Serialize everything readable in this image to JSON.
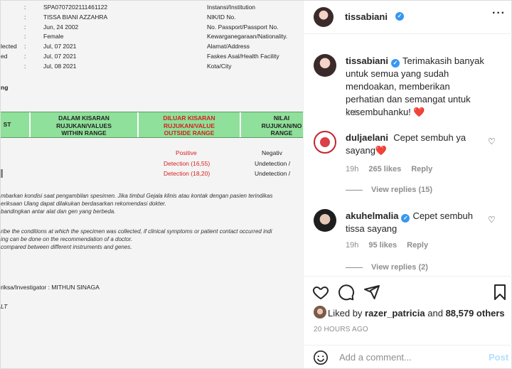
{
  "document": {
    "fields": [
      {
        "label": "",
        "value": "SPA0707202111461122"
      },
      {
        "label": "",
        "value": "TISSA BIANI AZZAHRA"
      },
      {
        "label": "",
        "value": "Jun, 24 2002"
      },
      {
        "label": "",
        "value": "Female"
      },
      {
        "label": "lected",
        "value": "Jul, 07 2021"
      },
      {
        "label": "ed",
        "value": "Jul, 07 2021"
      },
      {
        "label": "",
        "value": "Jul, 08 2021"
      }
    ],
    "right_labels": [
      "Instansi/Institution",
      "NIK/ID No.",
      "No. Passport/Passport No.",
      "Kewarganegaraan/Nationality.",
      "Alamat/Address",
      "Faskes Asal/Health Facility",
      "Kota/City"
    ],
    "section_fragment": "ng",
    "table_headers": {
      "col1": "ST",
      "col2": "DALAM KISARAN\nRUJUKAN/VALUES\nWITHIN RANGE",
      "col3": "DILUAR KISARAN\nRUJUKAN/VALUE\nOUTSIDE RANGE",
      "col4": "NILAI\nRUJUKAN/NO\nRANGE"
    },
    "results": [
      {
        "outside": "Positive",
        "reference": "Negativ"
      },
      {
        "outside": "Detection (16,55)",
        "reference": "Undetection /"
      },
      {
        "outside": "Detection (18,20)",
        "reference": "Undetection /"
      }
    ],
    "notes_id": [
      "mbarkan kondisi saat pengambilan spesimen. Jika timbul Gejala klinis atau kontak dengan pasien terindikas",
      "eriksaan Ulang dapat dilakukan berdasarkan rekomendasi dokter.",
      "bandingkan antar alat dan gen yang berbeda."
    ],
    "notes_en": [
      "ribe the conditions at which the specimen was collected, if clinical symptoms or patient contact occurred indi",
      "ing can be done on the recommendation of a doctor.",
      "compared between different instruments and genes."
    ],
    "investigator": "riksa/Investigator : MITHUN SINAGA",
    "footer_fragment": "LT"
  },
  "post": {
    "author": "tissabiani",
    "caption": "Terimakasih banyak untuk semua yang sudah mendoakan, memberikan perhatian dan semangat untuk kesembuhanku!",
    "caption_emoji": "❤️",
    "caption_time": "20h",
    "comments": [
      {
        "user": "duljaelani",
        "text": "Cepet sembuh ya sayang",
        "emoji": "❤️",
        "time": "19h",
        "likes": "265 likes",
        "reply": "Reply",
        "view_replies": "View replies (15)"
      },
      {
        "user": "akuhelmalia",
        "text": "Cepet sembuh tissa sayang",
        "time": "19h",
        "likes": "95 likes",
        "reply": "Reply",
        "view_replies": "View replies (2)"
      }
    ],
    "liked_by_prefix": "Liked by",
    "liked_by_user": "razer_patricia",
    "liked_by_and": "and",
    "liked_by_others": "88,579 others",
    "age": "20 HOURS AGO",
    "comment_placeholder": "Add a comment...",
    "post_label": "Post",
    "colors": {
      "accent": "#3897f0",
      "heart": "#ed1c24",
      "post_disabled": "#b2dffc",
      "lab_green": "#8fe09a",
      "lab_red": "#d61f1f"
    }
  }
}
